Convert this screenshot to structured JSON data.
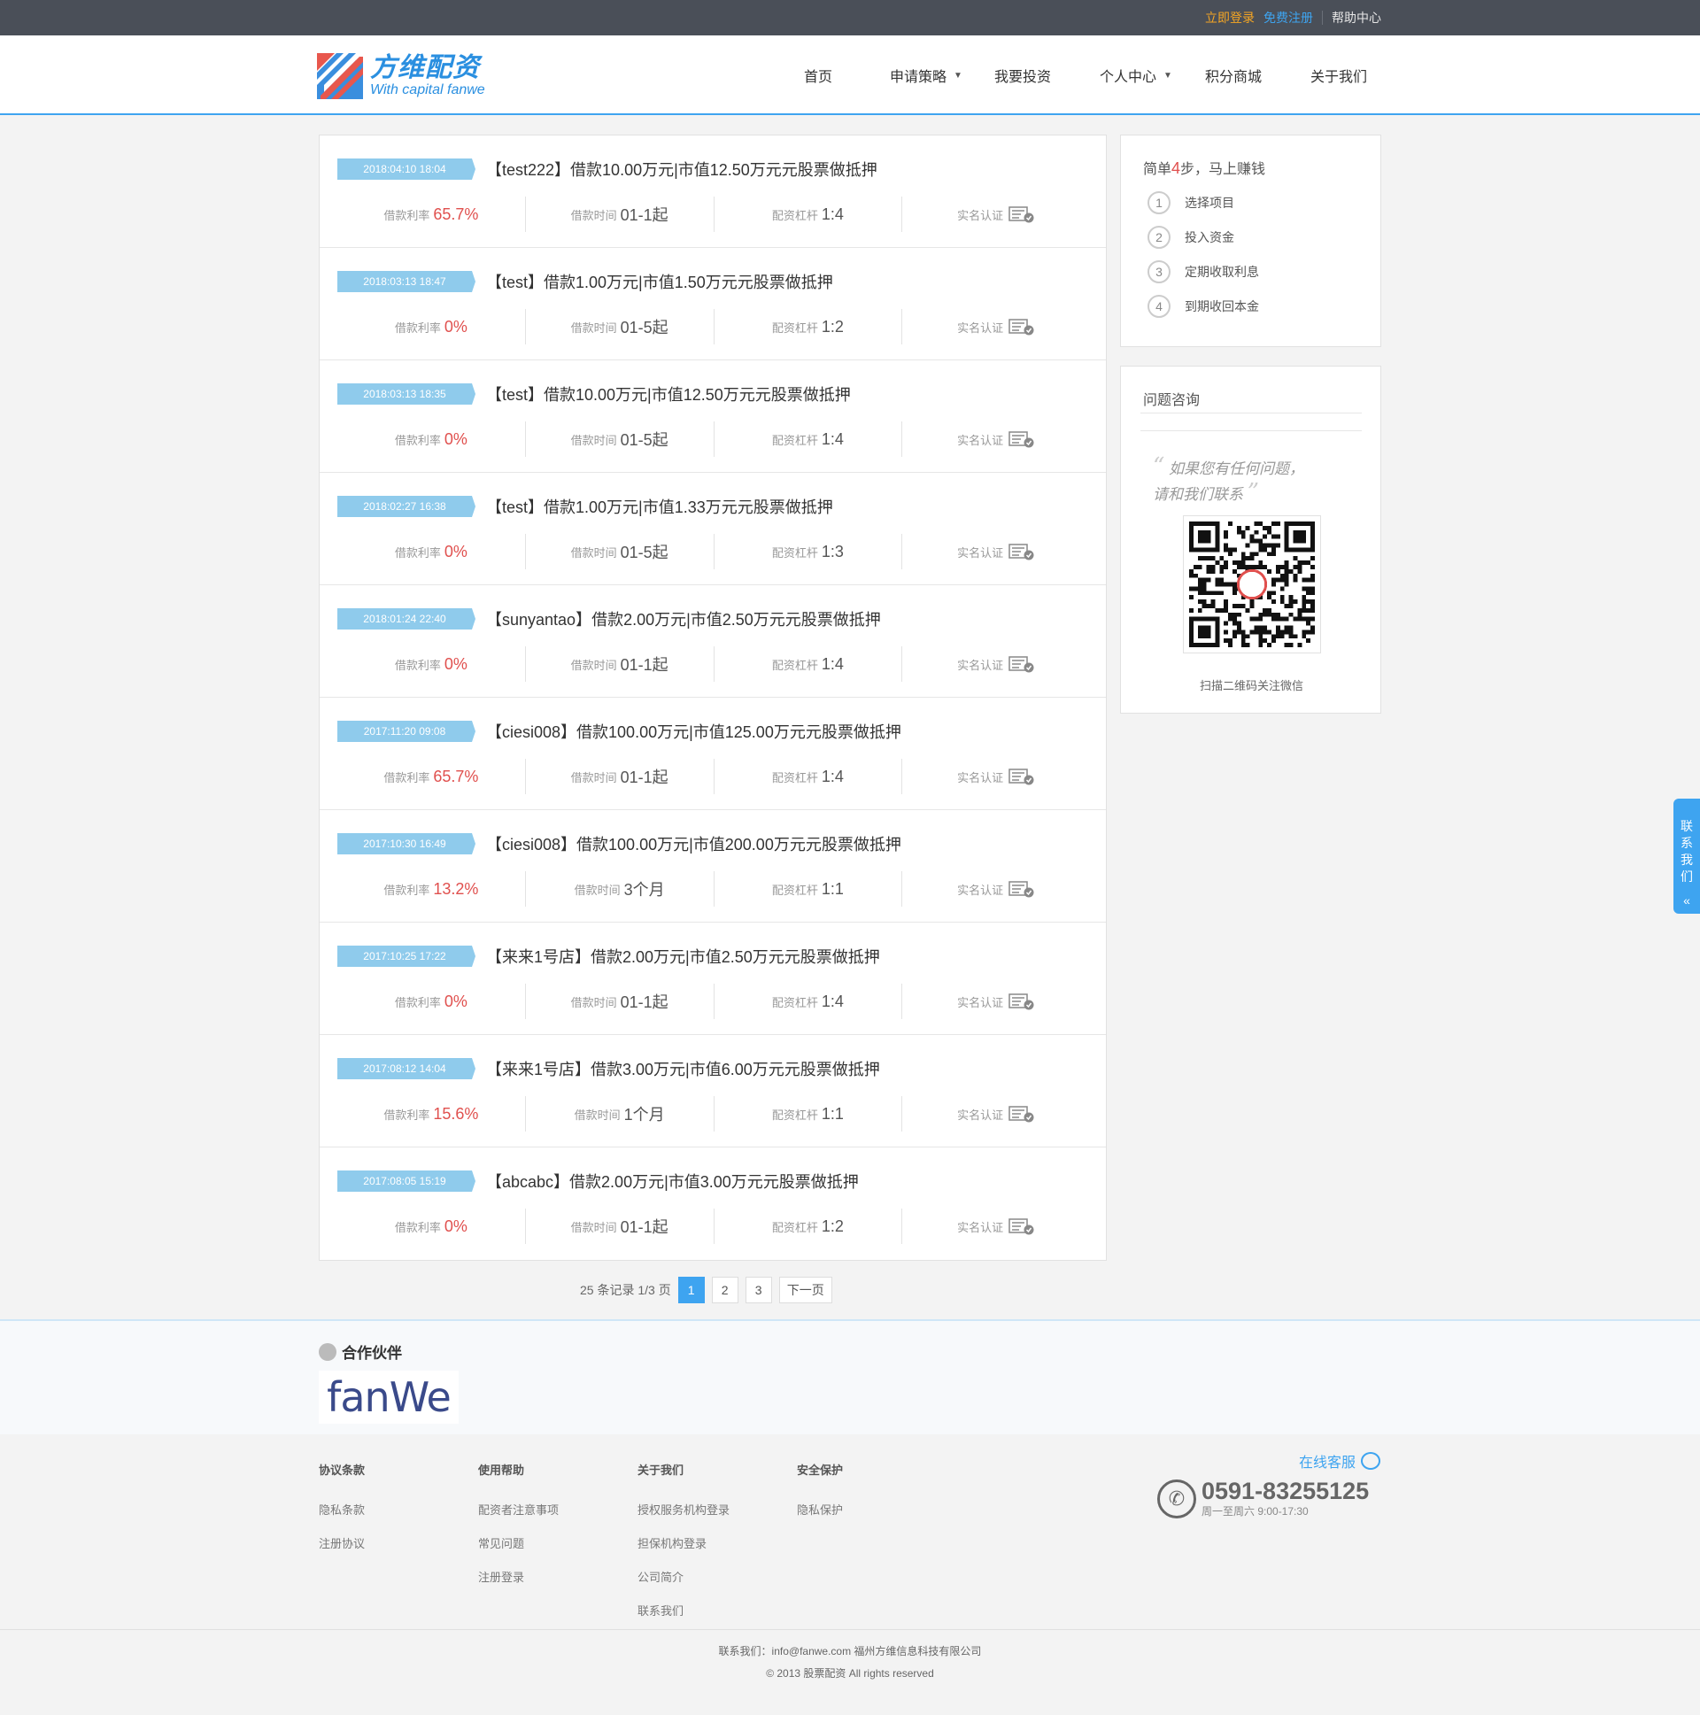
{
  "topbar": {
    "login": "立即登录",
    "register": "免费注册",
    "help": "帮助中心"
  },
  "header": {
    "logo_cn": "方维配资",
    "logo_en": "With capital fanwe",
    "nav": [
      "首页",
      "申请策略",
      "我要投资",
      "个人中心",
      "积分商城",
      "关于我们"
    ]
  },
  "labels": {
    "rate": "借款利率",
    "term": "借款时间",
    "leverage": "配资杠杆",
    "verify": "实名认证"
  },
  "loans": [
    {
      "date": "2018:04:10 18:04",
      "title": "【test222】借款10.00万元|市值12.50万元元股票做抵押",
      "rate": "65.7%",
      "term": "01-1起",
      "leverage": "1:4"
    },
    {
      "date": "2018:03:13 18:47",
      "title": "【test】借款1.00万元|市值1.50万元元股票做抵押",
      "rate": "0%",
      "term": "01-5起",
      "leverage": "1:2"
    },
    {
      "date": "2018:03:13 18:35",
      "title": "【test】借款10.00万元|市值12.50万元元股票做抵押",
      "rate": "0%",
      "term": "01-5起",
      "leverage": "1:4"
    },
    {
      "date": "2018:02:27 16:38",
      "title": "【test】借款1.00万元|市值1.33万元元股票做抵押",
      "rate": "0%",
      "term": "01-5起",
      "leverage": "1:3"
    },
    {
      "date": "2018:01:24 22:40",
      "title": "【sunyantao】借款2.00万元|市值2.50万元元股票做抵押",
      "rate": "0%",
      "term": "01-1起",
      "leverage": "1:4"
    },
    {
      "date": "2017:11:20 09:08",
      "title": "【ciesi008】借款100.00万元|市值125.00万元元股票做抵押",
      "rate": "65.7%",
      "term": "01-1起",
      "leverage": "1:4"
    },
    {
      "date": "2017:10:30 16:49",
      "title": "【ciesi008】借款100.00万元|市值200.00万元元股票做抵押",
      "rate": "13.2%",
      "term": "3个月",
      "leverage": "1:1"
    },
    {
      "date": "2017:10:25 17:22",
      "title": "【来来1号店】借款2.00万元|市值2.50万元元股票做抵押",
      "rate": "0%",
      "term": "01-1起",
      "leverage": "1:4"
    },
    {
      "date": "2017:08:12 14:04",
      "title": "【来来1号店】借款3.00万元|市值6.00万元元股票做抵押",
      "rate": "15.6%",
      "term": "1个月",
      "leverage": "1:1"
    },
    {
      "date": "2017:08:05 15:19",
      "title": "【abcabc】借款2.00万元|市值3.00万元元股票做抵押",
      "rate": "0%",
      "term": "01-1起",
      "leverage": "1:2"
    }
  ],
  "pager": {
    "info": "25 条记录 1/3 页",
    "pages": [
      "1",
      "2",
      "3"
    ],
    "next": "下一页",
    "current": "1"
  },
  "steps": {
    "head_pre": "简单",
    "head_num": "4",
    "head_post": "步，马上赚钱",
    "items": [
      {
        "num": "1",
        "label": "选择项目"
      },
      {
        "num": "2",
        "label": "投入资金"
      },
      {
        "num": "3",
        "label": "定期收取利息"
      },
      {
        "num": "4",
        "label": "到期收回本金"
      }
    ]
  },
  "consult": {
    "head": "问题咨询",
    "quote_line1": "如果您有任何问题，",
    "quote_line2": "请和我们联系",
    "qr_caption": "扫描二维码关注微信"
  },
  "float_tab": "联系我们",
  "partner": {
    "title": "合作伙伴",
    "logo_text": "fanWe"
  },
  "footer": {
    "columns": [
      {
        "head": "协议条款",
        "items": [
          "隐私条款",
          "注册协议"
        ]
      },
      {
        "head": "使用帮助",
        "items": [
          "配资者注意事项",
          "常见问题",
          "注册登录"
        ]
      },
      {
        "head": "关于我们",
        "items": [
          "授权服务机构登录",
          "担保机构登录",
          "公司简介",
          "联系我们"
        ]
      },
      {
        "head": "安全保护",
        "items": [
          "隐私保护"
        ]
      }
    ],
    "service": "在线客服",
    "phone": "0591-83255125",
    "hours": "周一至周六 9:00-17:30",
    "contact_line": "联系我们：info@fanwe.com    福州方维信息科技有限公司",
    "copyright": "© 2013 股票配资 All rights reserved"
  },
  "colors": {
    "accent": "#3ea4f0",
    "rate_red": "#e0504e",
    "date_tag": "#8fcbec",
    "topbar": "#4a4f58",
    "login_orange": "#f5a623"
  }
}
